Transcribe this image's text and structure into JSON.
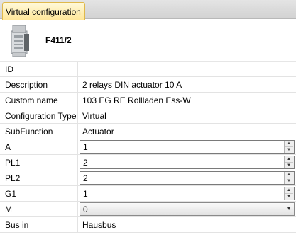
{
  "tab": {
    "label": "Virtual configuration"
  },
  "device": {
    "name": "F411/2",
    "icon": "din-rail-module-icon"
  },
  "rows": [
    {
      "key": "id",
      "label": "ID",
      "value": ""
    },
    {
      "key": "description",
      "label": "Description",
      "value": "2 relays DIN actuator 10 A"
    },
    {
      "key": "custom-name",
      "label": "Custom name",
      "value": "103 EG RE Rollladen Ess-W"
    },
    {
      "key": "configuration-type",
      "label": "Configuration Type",
      "value": "Virtual"
    },
    {
      "key": "subfunction",
      "label": "SubFunction",
      "value": "Actuator"
    },
    {
      "key": "a",
      "label": "A",
      "value": "1"
    },
    {
      "key": "pl1",
      "label": "PL1",
      "value": "2"
    },
    {
      "key": "pl2",
      "label": "PL2",
      "value": "2"
    },
    {
      "key": "g1",
      "label": "G1",
      "value": "1"
    },
    {
      "key": "m",
      "label": "M",
      "value": "0"
    },
    {
      "key": "bus-in",
      "label": "Bus in",
      "value": "Hausbus"
    }
  ],
  "colors": {
    "tab_border": "#e0b94a",
    "tab_fill": "#ffe79a"
  }
}
